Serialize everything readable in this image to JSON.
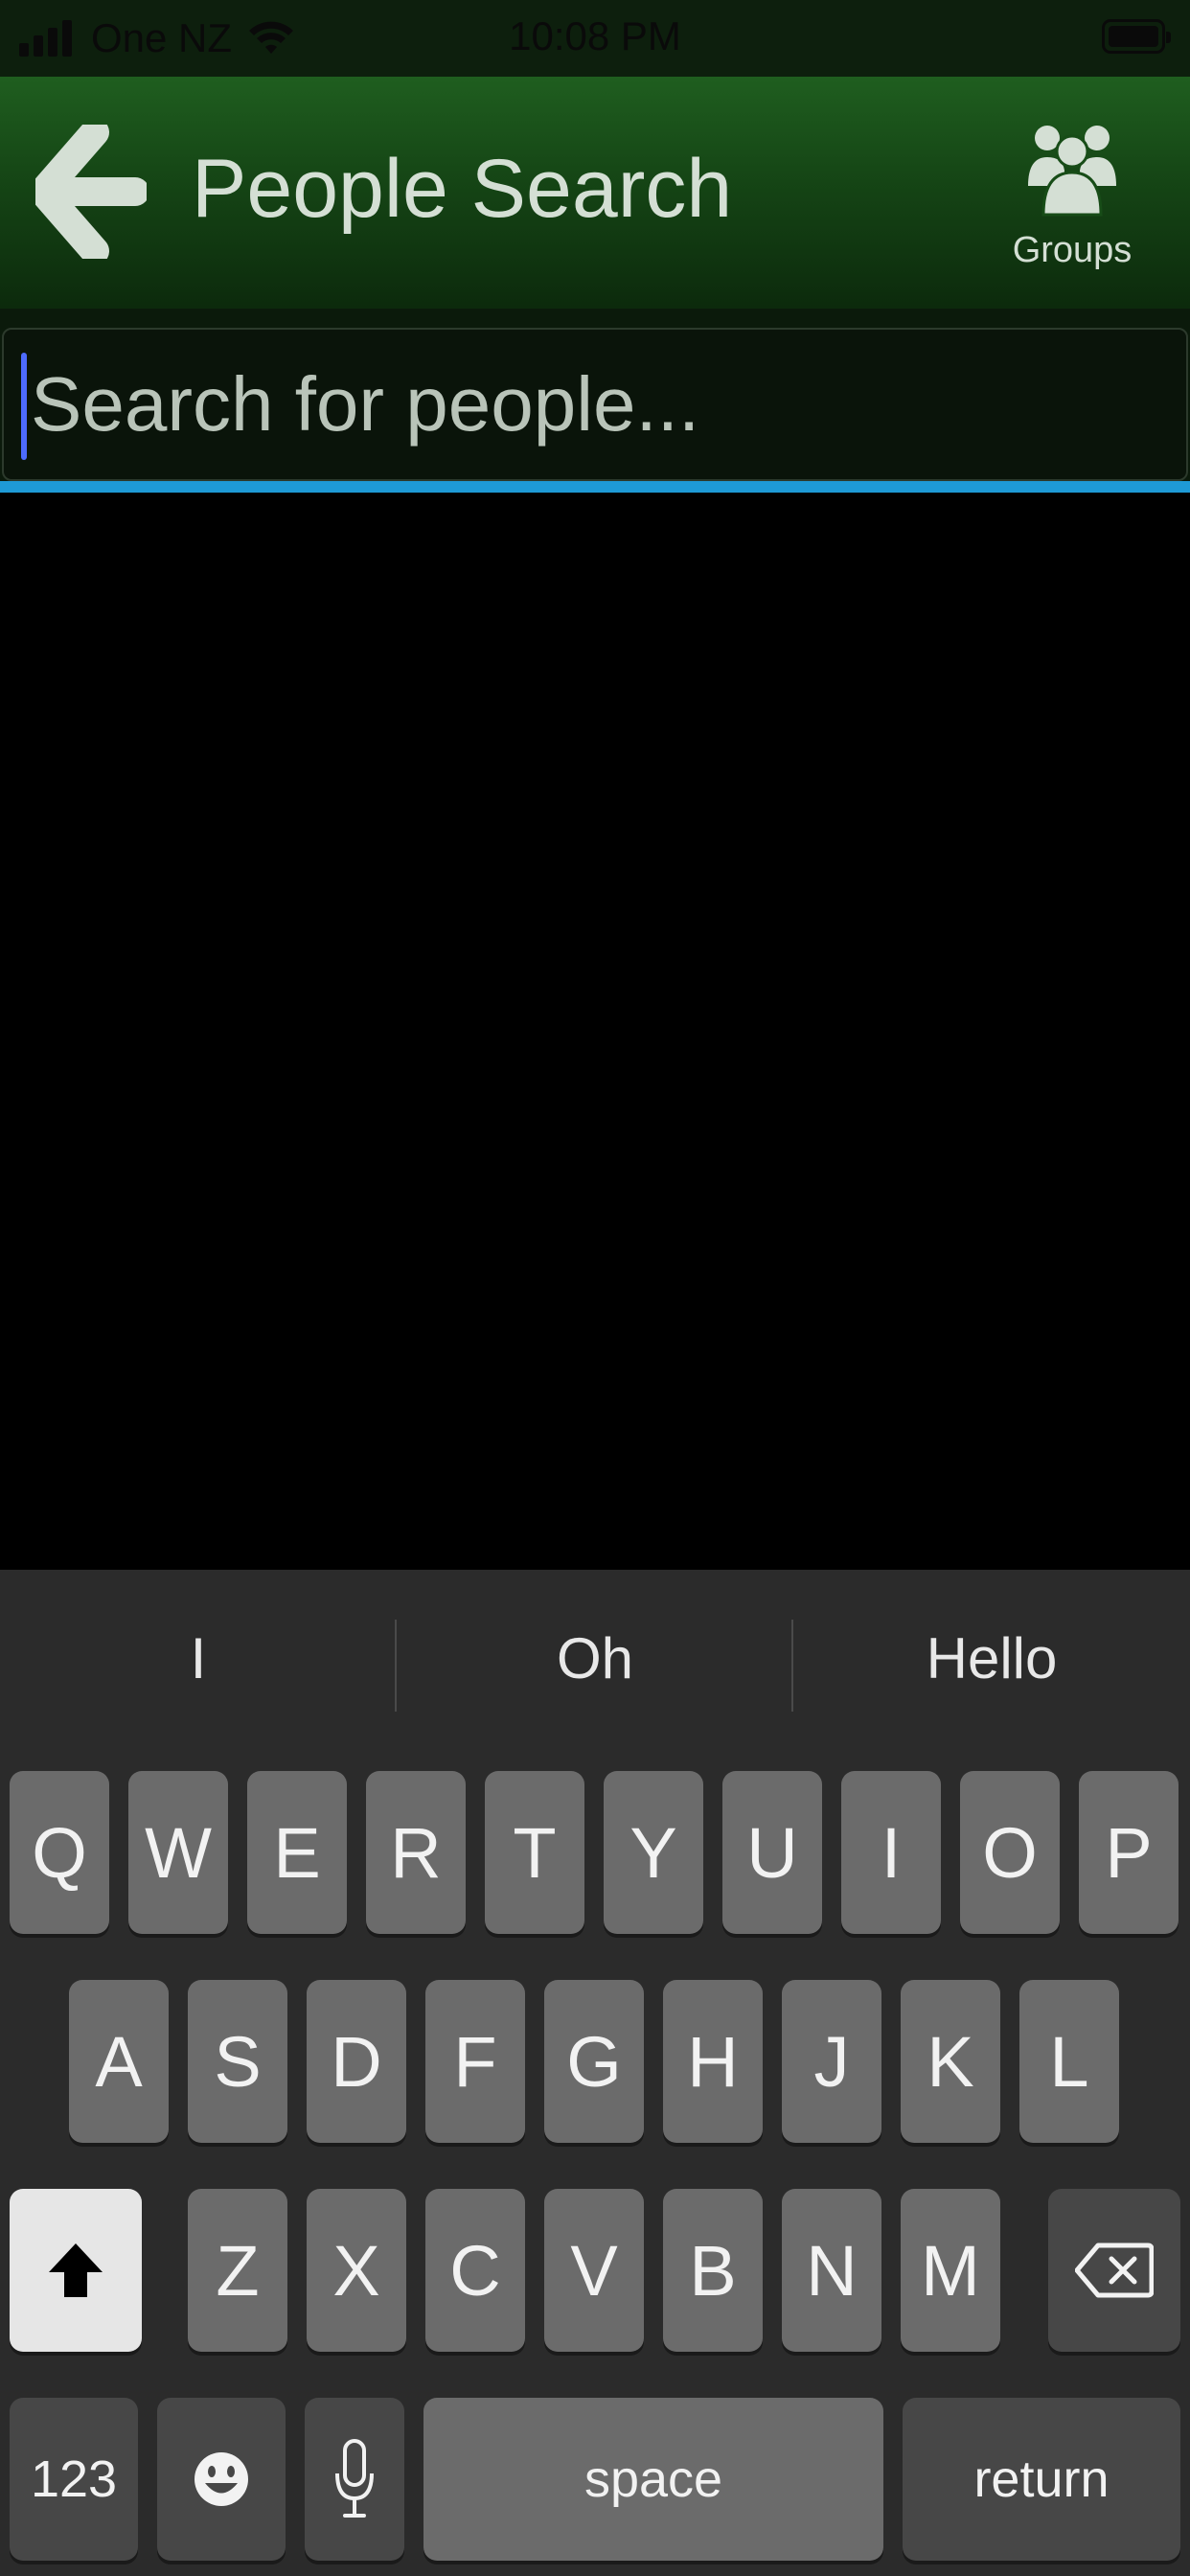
{
  "status_bar": {
    "carrier": "One NZ",
    "time": "10:08 PM"
  },
  "nav": {
    "title": "People Search",
    "groups_label": "Groups"
  },
  "search": {
    "placeholder": "Search for people...",
    "accent_color": "#1e9ad6"
  },
  "keyboard": {
    "suggestions": [
      "I",
      "Oh",
      "Hello"
    ],
    "row1": [
      "Q",
      "W",
      "E",
      "R",
      "T",
      "Y",
      "U",
      "I",
      "O",
      "P"
    ],
    "row2": [
      "A",
      "S",
      "D",
      "F",
      "G",
      "H",
      "J",
      "K",
      "L"
    ],
    "row3": [
      "Z",
      "X",
      "C",
      "V",
      "B",
      "N",
      "M"
    ],
    "numbers_label": "123",
    "space_label": "space",
    "return_label": "return",
    "icons": {
      "shift": "shift-icon",
      "delete": "delete-icon",
      "emoji": "emoji-icon",
      "mic": "microphone-icon"
    }
  }
}
